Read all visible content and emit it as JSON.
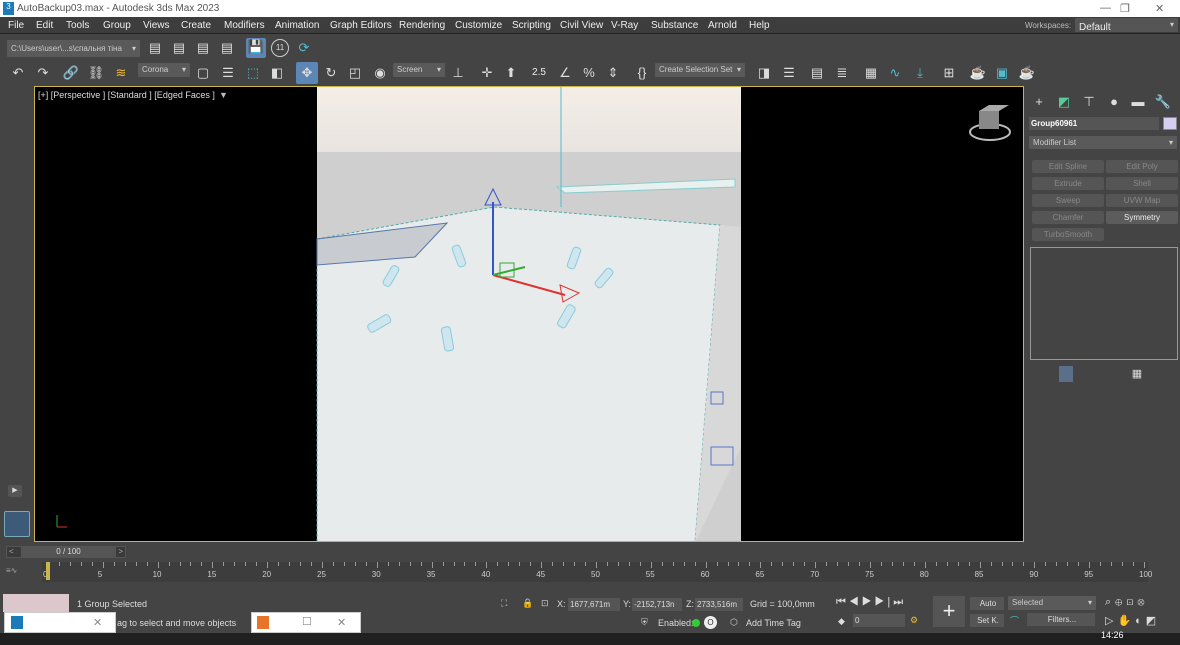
{
  "window": {
    "title": "AutoBackup03.max - Autodesk 3ds Max 2023",
    "minimize": "—",
    "maximize": "❐",
    "close": "✕"
  },
  "menu": [
    "File",
    "Edit",
    "Tools",
    "Group",
    "Views",
    "Create",
    "Modifiers",
    "Animation",
    "Graph Editors",
    "Rendering",
    "Customize",
    "Scripting",
    "Civil View",
    "V-Ray",
    "Substance",
    "Arnold",
    "Help"
  ],
  "workspaces": {
    "label": "Workspaces:",
    "value": "Default"
  },
  "toolbar1": {
    "project_path": "C:\\Users\\user\\...s\\спальня тіна",
    "badge": "11"
  },
  "toolbar2": {
    "renderer": "Corona",
    "coord_system": "Screen",
    "selection_set": "Create Selection Set",
    "snap_label": "2.5"
  },
  "viewport": {
    "label": "[+] [Perspective ] [Standard ] [Edged Faces ]"
  },
  "command_panel": {
    "object_name": "Group60961",
    "object_color": "#d6cff0",
    "modifier_list": "Modifier List",
    "modifiers": [
      "Edit Spline",
      "Edit Poly",
      "Extrude",
      "Shell",
      "Sweep",
      "UVW Map",
      "Chamfer",
      "Symmetry",
      "TurboSmooth"
    ]
  },
  "timeline": {
    "slider": "0 / 100",
    "current_frame": 0,
    "total_frames": 100,
    "ticks": [
      0,
      5,
      10,
      15,
      20,
      25,
      30,
      35,
      40,
      45,
      50,
      55,
      60,
      65,
      70,
      75,
      80,
      85,
      90,
      95,
      100
    ]
  },
  "status": {
    "selection": "1 Group Selected",
    "prompt": "ag to select and move objects",
    "x": "1677,671m",
    "y": "-2152,713n",
    "z": "2733,516m",
    "grid": "Grid = 100,0mm",
    "enabled_label": "Enabled:",
    "add_time_tag": "Add Time Tag",
    "frame_value": "0",
    "auto": "Auto",
    "set_key": "Set K.",
    "key_filter": "Selected",
    "filters": "Filters...",
    "clock": "14:26"
  }
}
